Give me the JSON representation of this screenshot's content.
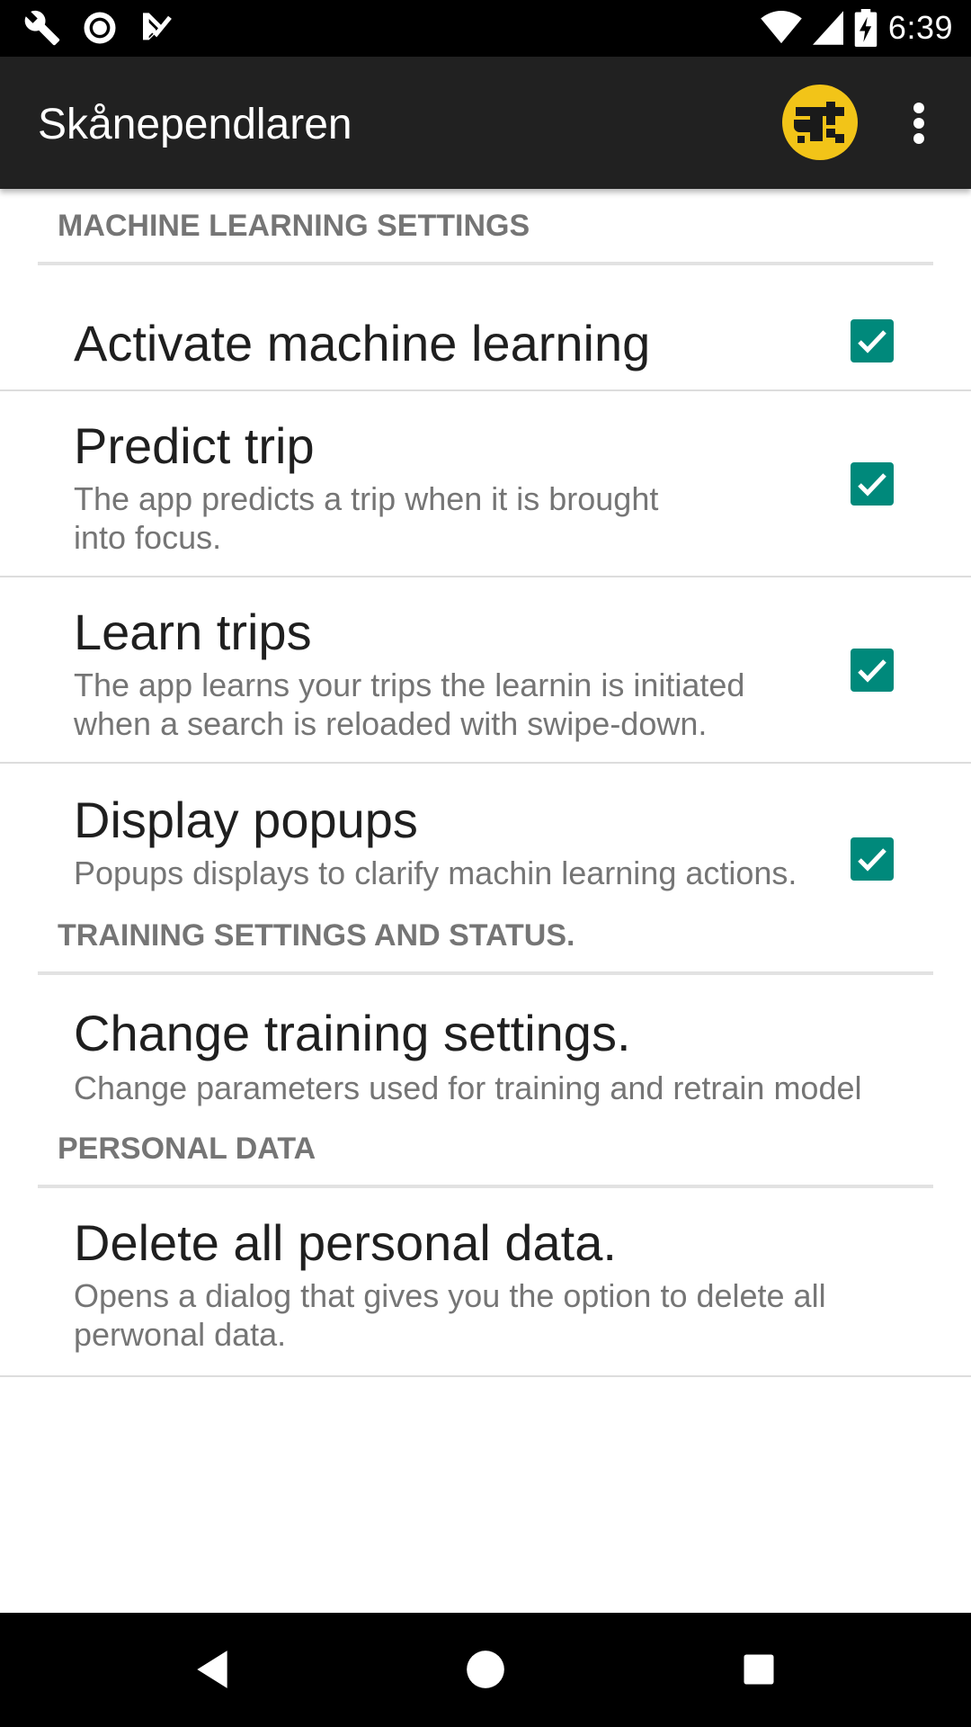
{
  "status_bar": {
    "time": "6:39",
    "left_icons": [
      "wrench-icon",
      "record-icon",
      "checkmark-flag-icon"
    ],
    "right_icons": [
      "wifi-icon",
      "cell-signal-icon",
      "battery-charging-icon"
    ]
  },
  "app_bar": {
    "title": "Skånependlaren",
    "logo": "skanetrafiken-logo-icon",
    "overflow_icon": "more-vert-icon"
  },
  "sections": [
    {
      "title": "MACHINE LEARNING SETTINGS",
      "items": [
        {
          "title": "Activate machine learning",
          "summary": "",
          "checked": true
        },
        {
          "title": "Predict trip",
          "summary": "The app predicts a trip when it is brought into focus.",
          "checked": true
        },
        {
          "title": "Learn trips",
          "summary": "The app learns your trips the learnin is initiated when a search is reloaded with swipe-down.",
          "checked": true
        },
        {
          "title": "Display popups",
          "summary": "Popups displays to clarify machin learning actions.",
          "checked": true
        }
      ]
    },
    {
      "title": "TRAINING SETTINGS AND STATUS.",
      "items": [
        {
          "title": "Change training settings.",
          "summary": "Change parameters used for training and retrain model"
        }
      ]
    },
    {
      "title": "PERSONAL DATA",
      "items": [
        {
          "title": "Delete all personal data.",
          "summary": "Opens a dialog that gives you the option to delete all perwonal data."
        }
      ]
    }
  ],
  "nav_bar": {
    "buttons": [
      "back-icon",
      "home-icon",
      "recents-icon"
    ]
  },
  "colors": {
    "status_bar": "#000000",
    "app_bar": "#212121",
    "accent": "#00897b",
    "logo_yellow": "#f2c418",
    "category_text": "#757575",
    "title_text": "#1f1f1f"
  }
}
